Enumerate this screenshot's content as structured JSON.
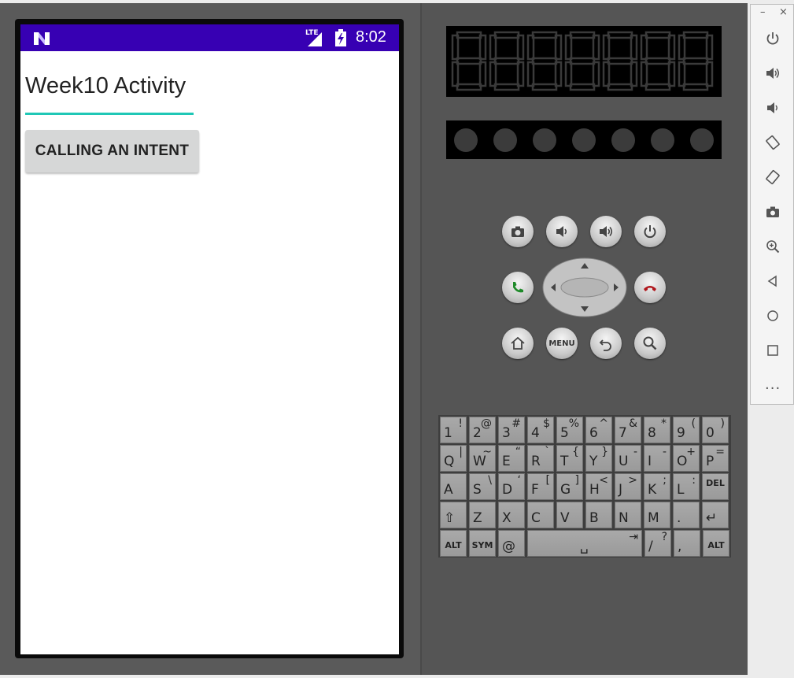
{
  "status_bar": {
    "network": "LTE",
    "time": "8:02"
  },
  "app": {
    "edittext_value": "Week10 Activity",
    "button_label": "CALLING AN INTENT"
  },
  "colors": {
    "status_bar": "#3700b3",
    "edittext_underline": "#1fc7b6",
    "button_bg": "#d6d7d7"
  },
  "hardware_controls": {
    "row1": [
      "camera-icon",
      "volume-down-icon",
      "volume-up-icon",
      "power-icon"
    ],
    "row2": [
      "call-icon",
      "dpad",
      "end-call-icon"
    ],
    "row3": [
      "home-icon",
      "menu-button",
      "back-icon",
      "search-icon"
    ],
    "menu_label": "MENU"
  },
  "keyboard": {
    "rows": [
      [
        [
          "1",
          "!"
        ],
        [
          "2",
          "@"
        ],
        [
          "3",
          "#"
        ],
        [
          "4",
          "$"
        ],
        [
          "5",
          "%"
        ],
        [
          "6",
          "^"
        ],
        [
          "7",
          "&"
        ],
        [
          "8",
          "*"
        ],
        [
          "9",
          "("
        ],
        [
          "0",
          ")"
        ]
      ],
      [
        [
          "Q",
          "|"
        ],
        [
          "W",
          "~"
        ],
        [
          "E",
          "“"
        ],
        [
          "R",
          "`"
        ],
        [
          "T",
          "{"
        ],
        [
          "Y",
          "}"
        ],
        [
          "U",
          "-"
        ],
        [
          "I",
          "-"
        ],
        [
          "O",
          "+"
        ],
        [
          "P",
          "="
        ]
      ],
      [
        [
          "A",
          ""
        ],
        [
          "S",
          "\\"
        ],
        [
          "D",
          "‘"
        ],
        [
          "F",
          "["
        ],
        [
          "G",
          "]"
        ],
        [
          "H",
          "<"
        ],
        [
          "J",
          ">"
        ],
        [
          "K",
          ";"
        ],
        [
          "L",
          ":"
        ],
        [
          "DEL",
          ""
        ]
      ],
      [
        [
          "⇧",
          ""
        ],
        [
          "Z",
          ""
        ],
        [
          "X",
          ""
        ],
        [
          "C",
          ""
        ],
        [
          "V",
          ""
        ],
        [
          "B",
          ""
        ],
        [
          "N",
          ""
        ],
        [
          "M",
          ""
        ],
        [
          ".",
          ""
        ],
        [
          "↵",
          ""
        ]
      ]
    ],
    "bottom_row": {
      "alt_left": "ALT",
      "sym": "SYM",
      "at": "@",
      "space": "␣",
      "tab": "⇥",
      "slash": "/",
      "question": "?",
      "comma": ",",
      "alt_right": "ALT"
    }
  },
  "side_toolbar": {
    "window_controls": {
      "minimize": "–",
      "close": "×"
    },
    "buttons": [
      "power-icon",
      "volume-up-icon",
      "volume-down-icon",
      "rotate-left-icon",
      "rotate-right-icon",
      "screenshot-icon",
      "zoom-icon",
      "back-icon",
      "home-icon",
      "overview-icon"
    ],
    "more": "..."
  }
}
